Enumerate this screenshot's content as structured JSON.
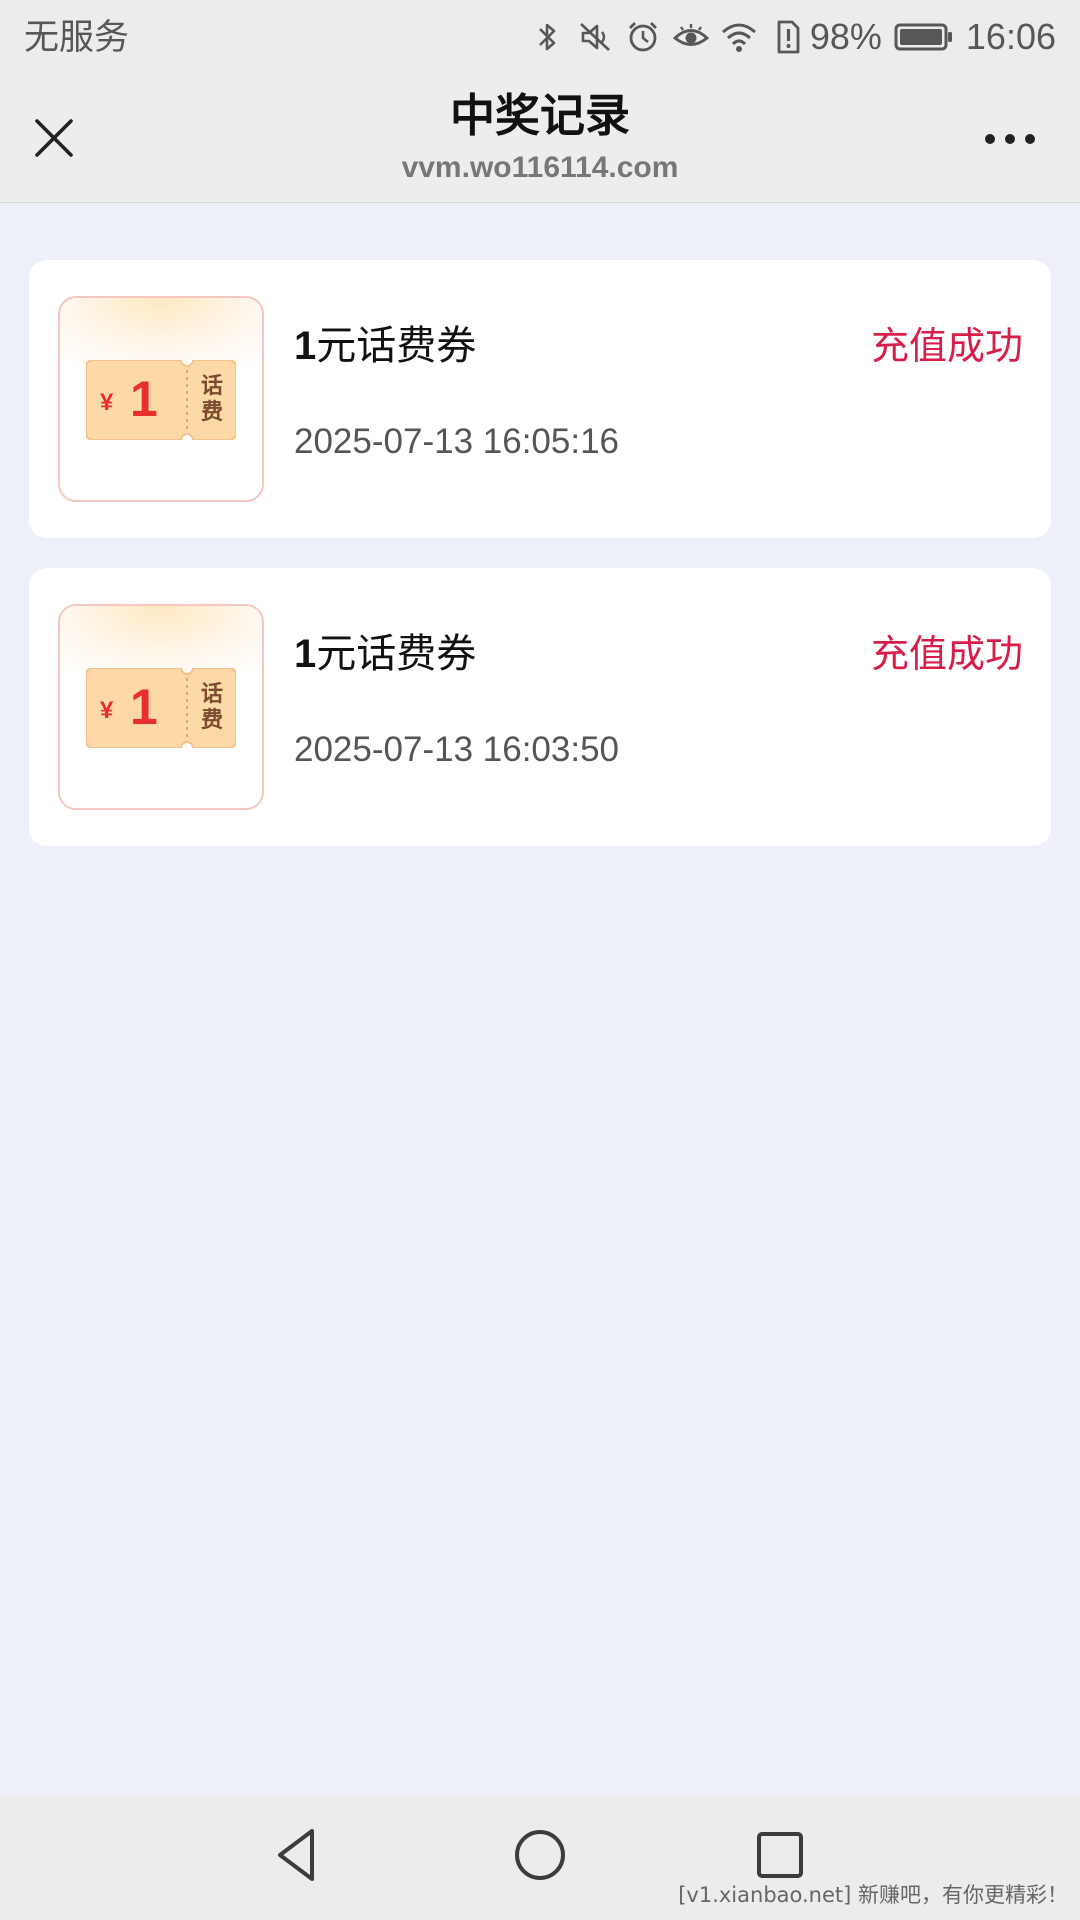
{
  "status_bar": {
    "carrier": "无服务",
    "battery_percent": "98%",
    "time": "16:06",
    "icons": [
      "bluetooth-icon",
      "mute-icon",
      "alarm-icon",
      "eye-icon",
      "wifi-icon",
      "sim-alert-icon",
      "battery-icon"
    ]
  },
  "nav": {
    "title": "中奖记录",
    "url": "vvm.wo116114.com",
    "close_icon": "close-icon",
    "more_icon": "more-icon"
  },
  "records": [
    {
      "ticket_currency": "¥",
      "ticket_amount": "1",
      "ticket_label": "话费",
      "title_number": "1",
      "title_text": "元话费券",
      "status": "充值成功",
      "time": "2025-07-13 16:05:16"
    },
    {
      "ticket_currency": "¥",
      "ticket_amount": "1",
      "ticket_label": "话费",
      "title_number": "1",
      "title_text": "元话费券",
      "status": "充值成功",
      "time": "2025-07-13 16:03:50"
    }
  ],
  "bottom_nav": {
    "back_icon": "back-icon",
    "home_icon": "home-icon",
    "recent_icon": "recent-apps-icon",
    "watermark": "[v1.xianbao.net] 新赚吧，有你更精彩！"
  },
  "colors": {
    "page_background": "#edf0f8",
    "status_success": "#d81e48",
    "ticket_red": "#e8312a",
    "ticket_fill": "#fcd9a6"
  }
}
